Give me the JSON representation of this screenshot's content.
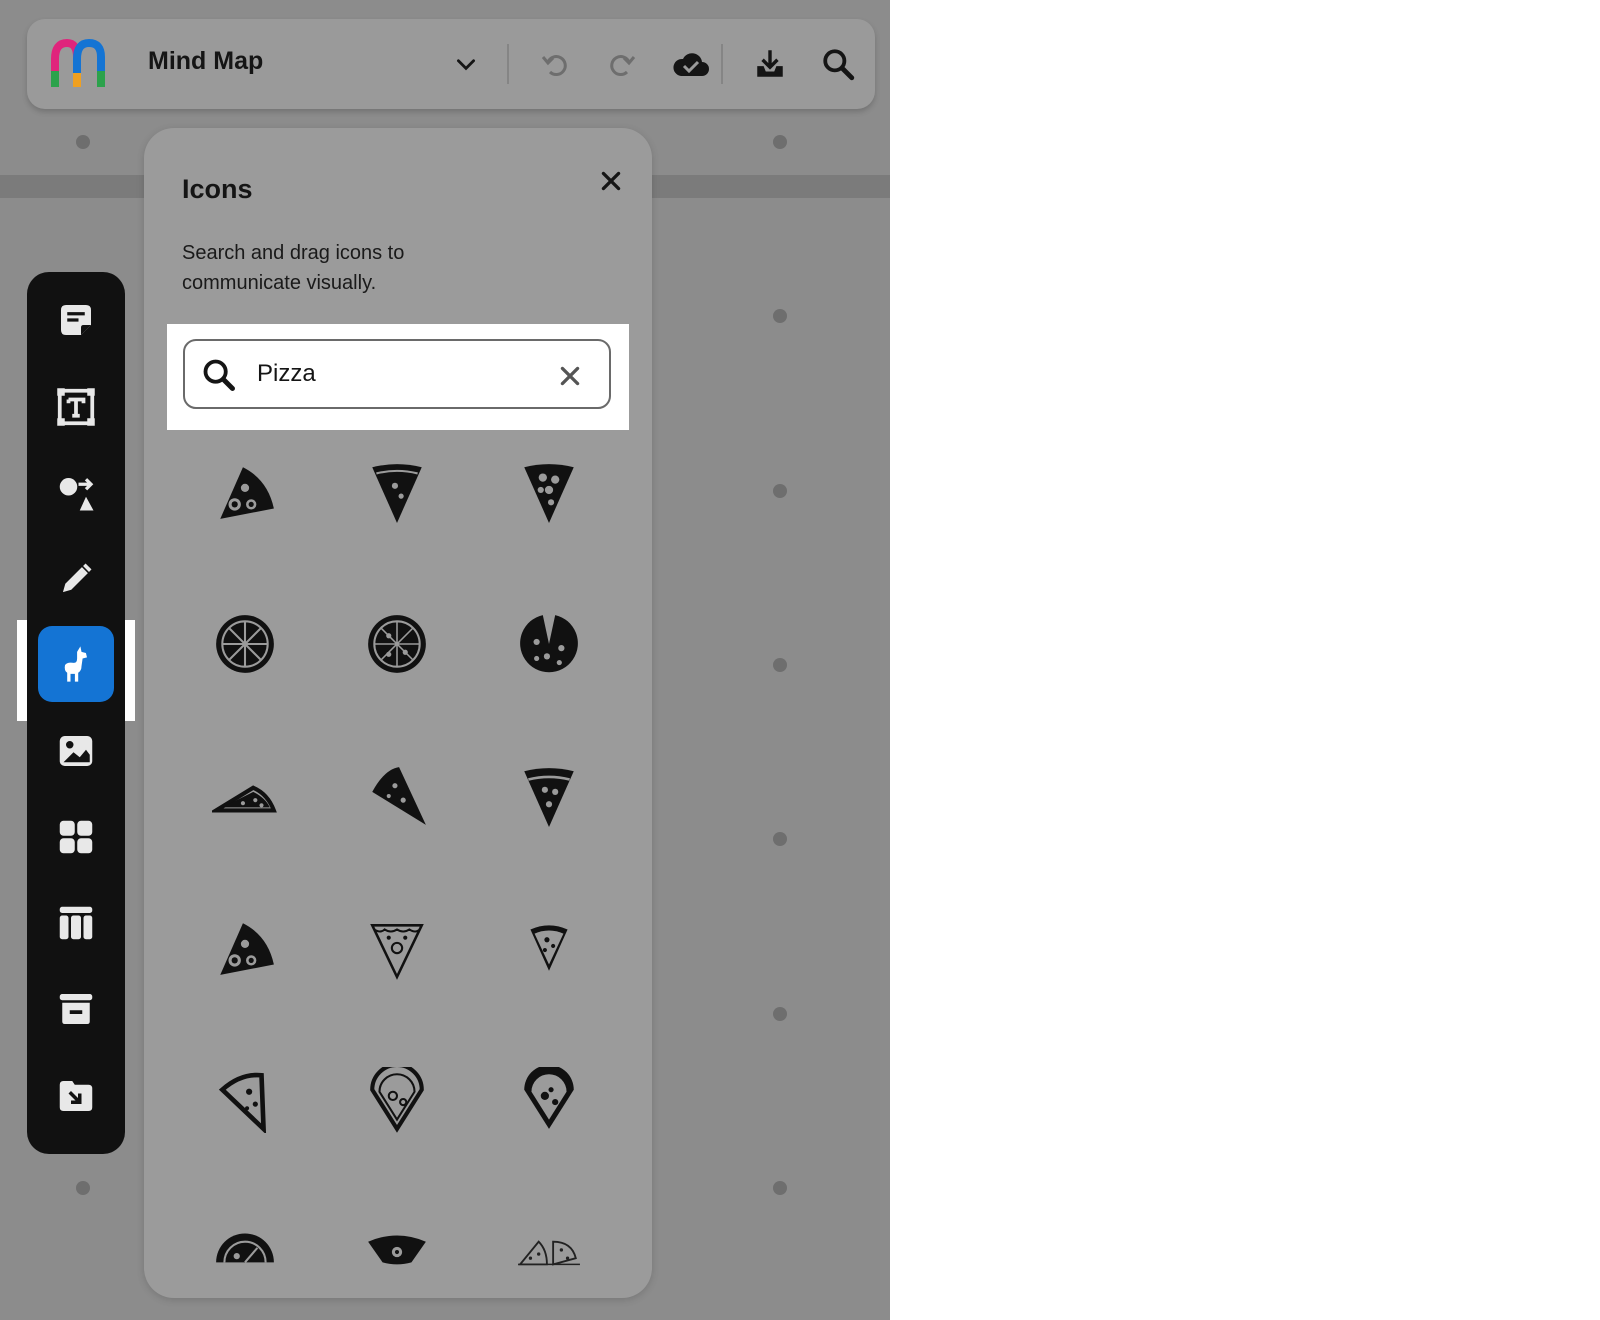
{
  "app": {
    "document_title": "Mind Map",
    "brand_colors": [
      "#e0247c",
      "#1474d4",
      "#2ca24c",
      "#f0a020"
    ]
  },
  "toolbar": {
    "items": [
      "chevron-down-icon",
      "undo-icon",
      "redo-icon",
      "cloud-saved-icon",
      "download-icon",
      "search-icon"
    ]
  },
  "tools": [
    {
      "name": "sticky-note-icon",
      "active": false
    },
    {
      "name": "text-icon",
      "active": false
    },
    {
      "name": "shapes-icon",
      "active": false
    },
    {
      "name": "pen-icon",
      "active": false
    },
    {
      "name": "llama-icon",
      "active": true
    },
    {
      "name": "image-icon",
      "active": false
    },
    {
      "name": "components-icon",
      "active": false
    },
    {
      "name": "table-icon",
      "active": false
    },
    {
      "name": "archive-icon",
      "active": false
    },
    {
      "name": "import-icon",
      "active": false
    }
  ],
  "accent_color": "#1474d4",
  "icons_panel": {
    "title": "Icons",
    "description": "Search and drag icons to communicate visually.",
    "search": {
      "value": "Pizza",
      "placeholder": ""
    },
    "results": [
      "pizza-slice-pepperoni-icon",
      "pizza-slice-down-icon",
      "pizza-slice-toppings-icon",
      "pizza-whole-outline-icon",
      "pizza-whole-cut-icon",
      "pizza-whole-missing-slice-icon",
      "pizza-slice-flat-icon",
      "pizza-slice-tilted-icon",
      "pizza-slice-crust-icon",
      "pizza-slice-pepperoni-icon",
      "pizza-slice-outline-icon",
      "pizza-slice-small-icon",
      "pizza-slice-line-icon",
      "pizza-slice-pin-icon",
      "pizza-slice-pin-filled-icon",
      "pizza-half-icon",
      "pizza-crust-icon",
      "pizza-slices-box-icon"
    ]
  }
}
